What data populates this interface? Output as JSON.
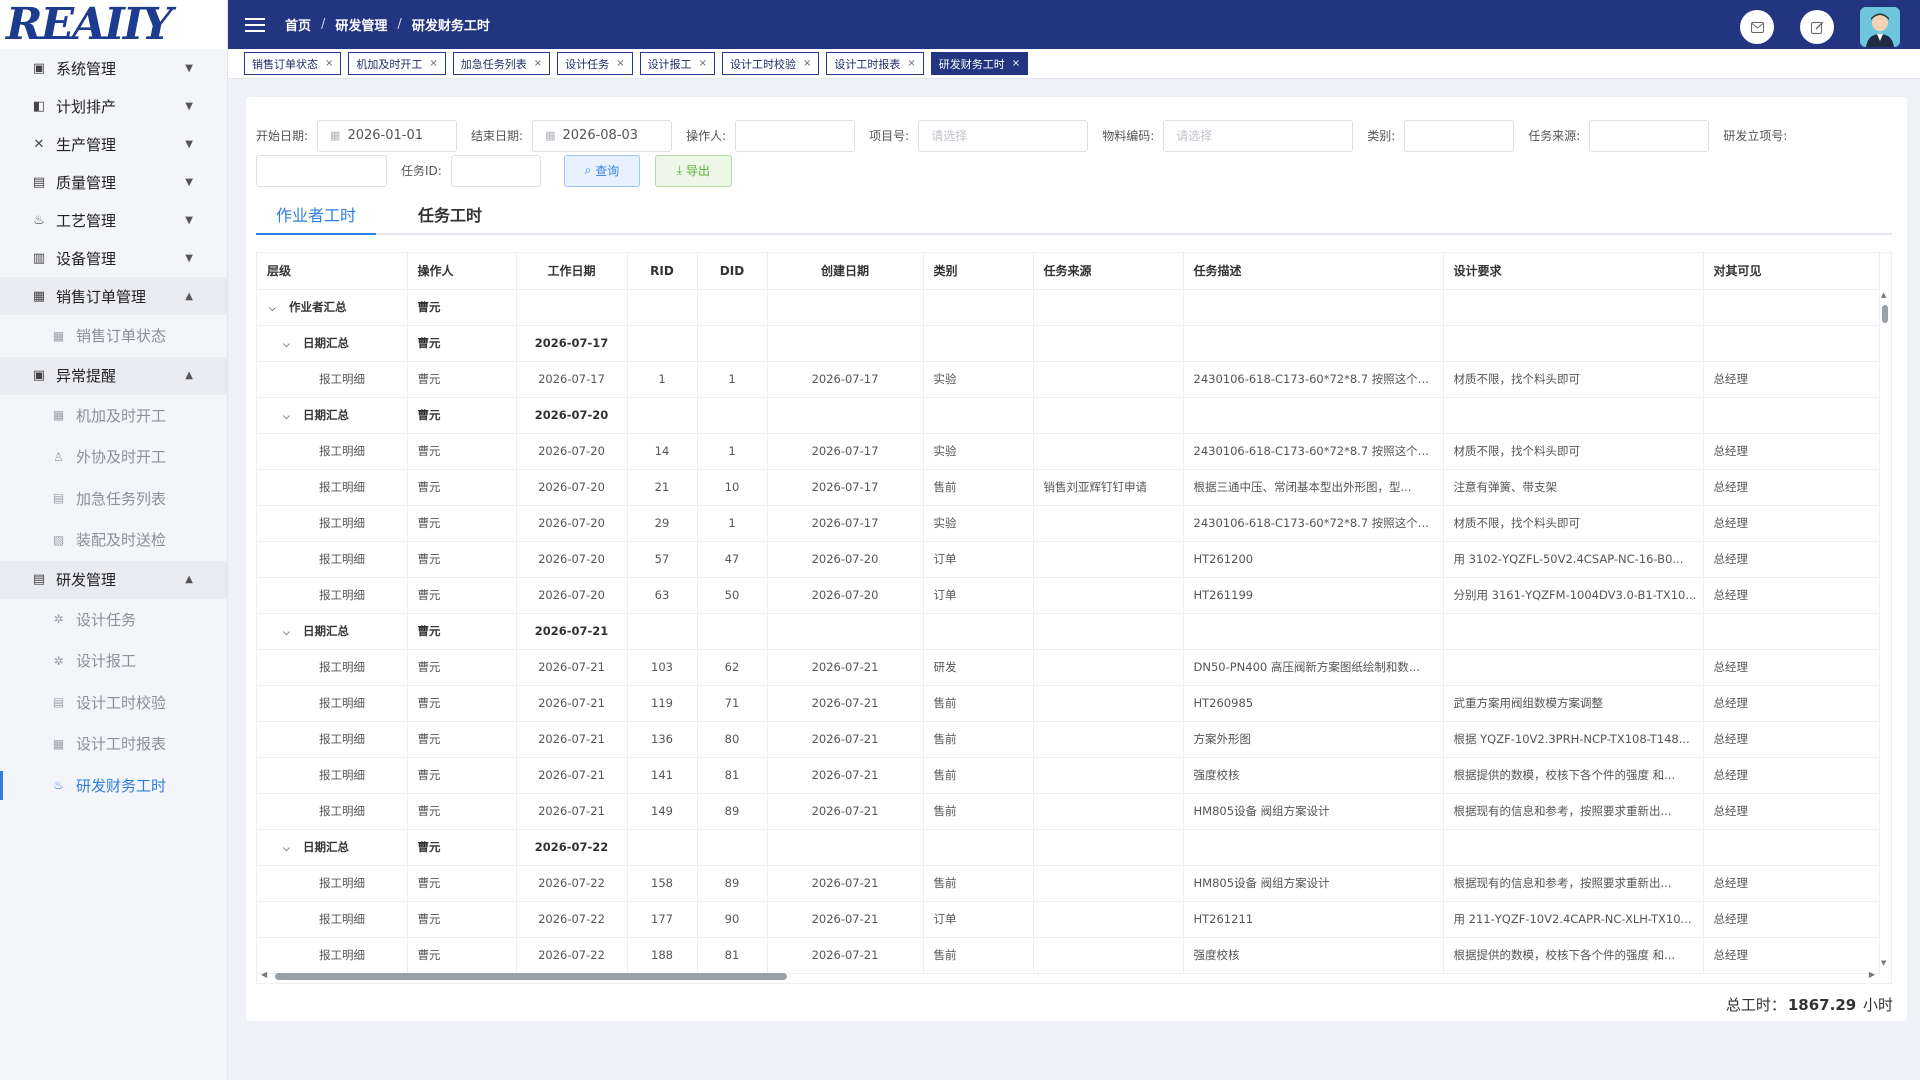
{
  "logo_text": "REAIIY",
  "breadcrumb": [
    "首页",
    "研发管理",
    "研发财务工时"
  ],
  "tags": [
    {
      "label": "销售订单状态",
      "active": false
    },
    {
      "label": "机加及时开工",
      "active": false
    },
    {
      "label": "加急任务列表",
      "active": false
    },
    {
      "label": "设计任务",
      "active": false
    },
    {
      "label": "设计报工",
      "active": false
    },
    {
      "label": "设计工时校验",
      "active": false
    },
    {
      "label": "设计工时报表",
      "active": false
    },
    {
      "label": "研发财务工时",
      "active": true
    }
  ],
  "sidebar": [
    {
      "label": "系统管理",
      "icon": "monitor-icon",
      "glyph": "▣",
      "arrow": "▼",
      "open": false
    },
    {
      "label": "计划排产",
      "icon": "schedule-icon",
      "glyph": "◧",
      "arrow": "▼",
      "open": false
    },
    {
      "label": "生产管理",
      "icon": "tools-icon",
      "glyph": "✕",
      "arrow": "▼",
      "open": false
    },
    {
      "label": "质量管理",
      "icon": "document-icon",
      "glyph": "▤",
      "arrow": "▼",
      "open": false
    },
    {
      "label": "工艺管理",
      "icon": "flask-icon",
      "glyph": "♨",
      "arrow": "▼",
      "open": false
    },
    {
      "label": "设备管理",
      "icon": "printer-icon",
      "glyph": "▥",
      "arrow": "▼",
      "open": false
    },
    {
      "label": "销售订单管理",
      "icon": "list-icon",
      "glyph": "▦",
      "arrow": "▲",
      "open": true,
      "children": [
        {
          "label": "销售订单状态",
          "icon": "list-icon",
          "glyph": "▦"
        }
      ]
    },
    {
      "label": "异常提醒",
      "icon": "monitor-icon",
      "glyph": "▣",
      "arrow": "▲",
      "open": true,
      "children": [
        {
          "label": "机加及时开工",
          "icon": "grid-icon",
          "glyph": "▦"
        },
        {
          "label": "外协及时开工",
          "icon": "user-icon",
          "glyph": "♙"
        },
        {
          "label": "加急任务列表",
          "icon": "edit-doc-icon",
          "glyph": "▤"
        },
        {
          "label": "装配及时送检",
          "icon": "form-icon",
          "glyph": "▧"
        }
      ]
    },
    {
      "label": "研发管理",
      "icon": "calendar-icon",
      "glyph": "▤",
      "arrow": "▲",
      "open": true,
      "children": [
        {
          "label": "设计任务",
          "icon": "gear-icon",
          "glyph": "✲"
        },
        {
          "label": "设计报工",
          "icon": "gear-icon",
          "glyph": "✲"
        },
        {
          "label": "设计工时校验",
          "icon": "edit-doc-icon",
          "glyph": "▤"
        },
        {
          "label": "设计工时报表",
          "icon": "list-icon",
          "glyph": "▦"
        },
        {
          "label": "研发财务工时",
          "icon": "flask-icon",
          "glyph": "♨",
          "active": true
        }
      ]
    }
  ],
  "filters": {
    "start_label": "开始日期:",
    "start_value": "2026-01-01",
    "end_label": "结束日期:",
    "end_value": "2026-08-03",
    "operator_label": "操作人:",
    "project_label": "项目号:",
    "project_placeholder": "请选择",
    "material_label": "物料编码:",
    "material_placeholder": "请选择",
    "category_label": "类别:",
    "source_label": "任务来源:",
    "rd_label": "研发立项号:",
    "taskid_label": "任务ID:",
    "query_label": "查询",
    "export_label": "导出"
  },
  "tabs": [
    "作业者工时",
    "任务工时"
  ],
  "columns": [
    "层级",
    "操作人",
    "工作日期",
    "RID",
    "DID",
    "创建日期",
    "类别",
    "任务来源",
    "任务描述",
    "设计要求",
    "对其可见"
  ],
  "rows": [
    {
      "level": 0,
      "caret": "⌵",
      "cells": [
        "作业者汇总",
        "曹元",
        "",
        "",
        "",
        "",
        "",
        "",
        "",
        "",
        ""
      ]
    },
    {
      "level": 1,
      "caret": "⌵",
      "cells": [
        "日期汇总",
        "曹元",
        "2026-07-17",
        "",
        "",
        "",
        "",
        "",
        "",
        "",
        ""
      ]
    },
    {
      "level": 2,
      "cells": [
        "报工明细",
        "曹元",
        "2026-07-17",
        "1",
        "1",
        "2026-07-17",
        "实验",
        "",
        "2430106-618-C173-60*72*8.7 按照这个...",
        "材质不限，找个料头即可",
        "总经理"
      ]
    },
    {
      "level": 1,
      "caret": "⌵",
      "cells": [
        "日期汇总",
        "曹元",
        "2026-07-20",
        "",
        "",
        "",
        "",
        "",
        "",
        "",
        ""
      ]
    },
    {
      "level": 2,
      "cells": [
        "报工明细",
        "曹元",
        "2026-07-20",
        "14",
        "1",
        "2026-07-17",
        "实验",
        "",
        "2430106-618-C173-60*72*8.7 按照这个...",
        "材质不限，找个料头即可",
        "总经理"
      ]
    },
    {
      "level": 2,
      "cells": [
        "报工明细",
        "曹元",
        "2026-07-20",
        "21",
        "10",
        "2026-07-17",
        "售前",
        "销售刘亚辉钉钉申请",
        "根据三通中压、常闭基本型出外形图，型...",
        "注意有弹簧、带支架",
        "总经理"
      ]
    },
    {
      "level": 2,
      "cells": [
        "报工明细",
        "曹元",
        "2026-07-20",
        "29",
        "1",
        "2026-07-17",
        "实验",
        "",
        "2430106-618-C173-60*72*8.7 按照这个...",
        "材质不限，找个料头即可",
        "总经理"
      ]
    },
    {
      "level": 2,
      "cells": [
        "报工明细",
        "曹元",
        "2026-07-20",
        "57",
        "47",
        "2026-07-20",
        "订单",
        "",
        "HT261200",
        "用 3102-YQZFL-50V2.4CSAP-NC-16-B0...",
        "总经理"
      ]
    },
    {
      "level": 2,
      "cells": [
        "报工明细",
        "曹元",
        "2026-07-20",
        "63",
        "50",
        "2026-07-20",
        "订单",
        "",
        "HT261199",
        "分别用 3161-YQZFM-1004DV3.0-B1-TX10...",
        "总经理"
      ]
    },
    {
      "level": 1,
      "caret": "⌵",
      "cells": [
        "日期汇总",
        "曹元",
        "2026-07-21",
        "",
        "",
        "",
        "",
        "",
        "",
        "",
        ""
      ]
    },
    {
      "level": 2,
      "cells": [
        "报工明细",
        "曹元",
        "2026-07-21",
        "103",
        "62",
        "2026-07-21",
        "研发",
        "",
        "DN50-PN400 高压阀新方案图纸绘制和数...",
        "",
        "总经理"
      ]
    },
    {
      "level": 2,
      "cells": [
        "报工明细",
        "曹元",
        "2026-07-21",
        "119",
        "71",
        "2026-07-21",
        "售前",
        "",
        "HT260985",
        "武重方案用阀组数模方案调整",
        "总经理"
      ]
    },
    {
      "level": 2,
      "cells": [
        "报工明细",
        "曹元",
        "2026-07-21",
        "136",
        "80",
        "2026-07-21",
        "售前",
        "",
        "方案外形图",
        "根据 YQZF-10V2.3PRH-NCP-TX108-T148...",
        "总经理"
      ]
    },
    {
      "level": 2,
      "cells": [
        "报工明细",
        "曹元",
        "2026-07-21",
        "141",
        "81",
        "2026-07-21",
        "售前",
        "",
        "强度校核",
        "根据提供的数模，校核下各个件的强度 和...",
        "总经理"
      ]
    },
    {
      "level": 2,
      "cells": [
        "报工明细",
        "曹元",
        "2026-07-21",
        "149",
        "89",
        "2026-07-21",
        "售前",
        "",
        "HM805设备 阀组方案设计",
        "根据现有的信息和参考，按照要求重新出...",
        "总经理"
      ]
    },
    {
      "level": 1,
      "caret": "⌵",
      "cells": [
        "日期汇总",
        "曹元",
        "2026-07-22",
        "",
        "",
        "",
        "",
        "",
        "",
        "",
        ""
      ]
    },
    {
      "level": 2,
      "cells": [
        "报工明细",
        "曹元",
        "2026-07-22",
        "158",
        "89",
        "2026-07-21",
        "售前",
        "",
        "HM805设备 阀组方案设计",
        "根据现有的信息和参考，按照要求重新出...",
        "总经理"
      ]
    },
    {
      "level": 2,
      "cells": [
        "报工明细",
        "曹元",
        "2026-07-22",
        "177",
        "90",
        "2026-07-21",
        "订单",
        "",
        "HT261211",
        "用 211-YQZF-10V2.4CAPR-NC-XLH-TX10...",
        "总经理"
      ]
    },
    {
      "level": 2,
      "cells": [
        "报工明细",
        "曹元",
        "2026-07-22",
        "188",
        "81",
        "2026-07-21",
        "售前",
        "",
        "强度校核",
        "根据提供的数模，校核下各个件的强度 和...",
        "总经理"
      ]
    }
  ],
  "total": {
    "label": "总工时：",
    "value": "1867.29",
    "unit": "小时"
  },
  "colors": {
    "topbar": "#233480",
    "accent": "#2f7de1",
    "export": "#58b13a"
  }
}
